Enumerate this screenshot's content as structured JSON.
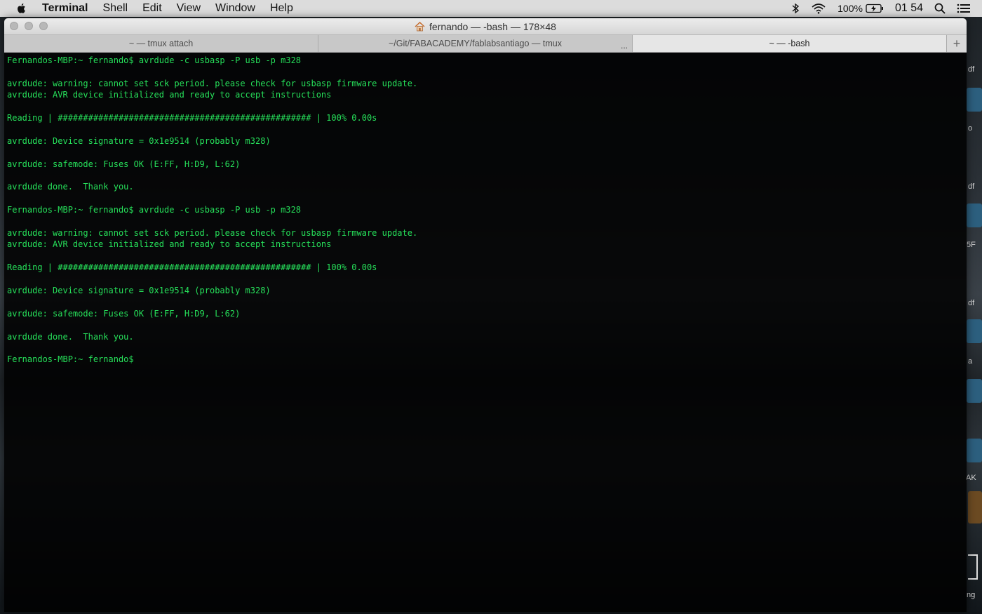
{
  "menubar": {
    "app_name": "Terminal",
    "items": [
      "Shell",
      "Edit",
      "View",
      "Window",
      "Help"
    ],
    "battery": "100%",
    "clock": "01 54"
  },
  "window": {
    "title": "fernando — -bash — 178×48",
    "tabs": [
      {
        "label": "~ — tmux attach"
      },
      {
        "label": "~/Git/FABACADEMY/fablabsantiago — tmux"
      },
      {
        "label": "~ — -bash"
      }
    ],
    "tab_overflow": "..."
  },
  "terminal": {
    "lines": [
      "Fernandos-MBP:~ fernando$ avrdude -c usbasp -P usb -p m328",
      "",
      "avrdude: warning: cannot set sck period. please check for usbasp firmware update.",
      "avrdude: AVR device initialized and ready to accept instructions",
      "",
      "Reading | ################################################## | 100% 0.00s",
      "",
      "avrdude: Device signature = 0x1e9514 (probably m328)",
      "",
      "avrdude: safemode: Fuses OK (E:FF, H:D9, L:62)",
      "",
      "avrdude done.  Thank you.",
      "",
      "Fernandos-MBP:~ fernando$ avrdude -c usbasp -P usb -p m328",
      "",
      "avrdude: warning: cannot set sck period. please check for usbasp firmware update.",
      "avrdude: AVR device initialized and ready to accept instructions",
      "",
      "Reading | ################################################## | 100% 0.00s",
      "",
      "avrdude: Device signature = 0x1e9514 (probably m328)",
      "",
      "avrdude: safemode: Fuses OK (E:FF, H:D9, L:62)",
      "",
      "avrdude done.  Thank you.",
      "",
      "Fernandos-MBP:~ fernando$"
    ]
  },
  "desktop": {
    "labels": [
      "df",
      "o",
      "df",
      "5F",
      "df",
      "a",
      "AK",
      "ng"
    ]
  }
}
